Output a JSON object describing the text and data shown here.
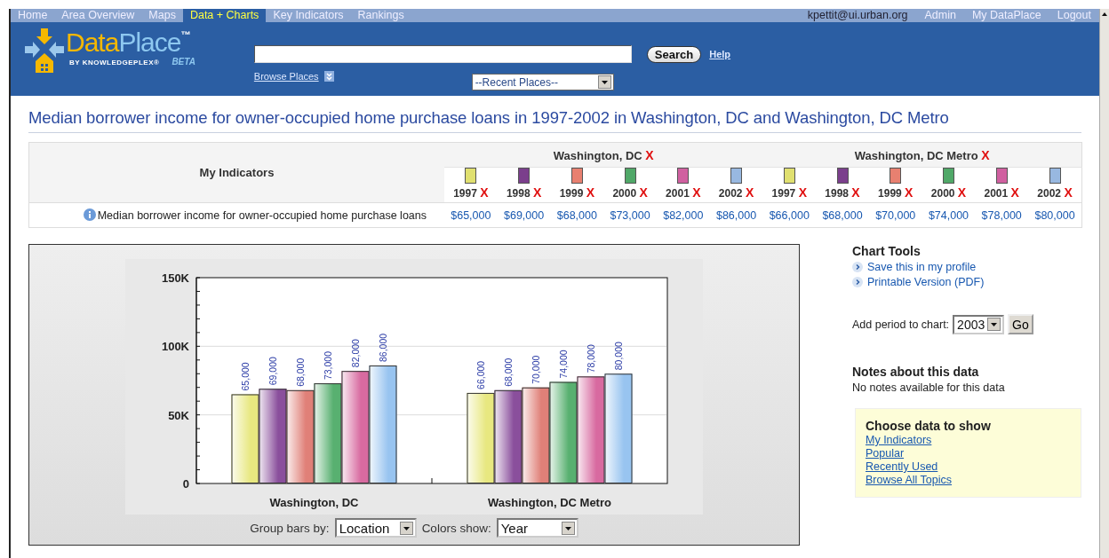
{
  "nav": {
    "tabs": [
      {
        "label": "Home",
        "selected": false
      },
      {
        "label": "Area Overview",
        "selected": false
      },
      {
        "label": "Maps",
        "selected": false
      },
      {
        "label": "Data + Charts",
        "selected": true
      },
      {
        "label": "Key Indicators",
        "selected": false
      },
      {
        "label": "Rankings",
        "selected": false
      }
    ],
    "user": "kpettit@ui.urban.org",
    "links": [
      "Admin",
      "My DataPlace",
      "Logout"
    ]
  },
  "header": {
    "logo": {
      "word_parts": [
        "Data",
        "Place"
      ],
      "trademark": "™",
      "byline": "BY KNOWLEDGEPLEX®",
      "beta": "BETA"
    },
    "search_button": "Search",
    "help": "Help",
    "browse": "Browse Places",
    "recent": "--Recent Places--"
  },
  "title": "Median borrower income for owner-occupied home purchase loans in 1997-2002 in Washington, DC and Washington, DC Metro",
  "table": {
    "corner": "My Indicators",
    "groups": [
      {
        "name": "Washington, DC",
        "remove": "X",
        "columns": [
          {
            "year": "1997",
            "remove": "X",
            "color": "#e0e070"
          },
          {
            "year": "1998",
            "remove": "X",
            "color": "#7b3f8c"
          },
          {
            "year": "1999",
            "remove": "X",
            "color": "#e88070"
          },
          {
            "year": "2000",
            "remove": "X",
            "color": "#50a868"
          },
          {
            "year": "2001",
            "remove": "X",
            "color": "#d060a0"
          },
          {
            "year": "2002",
            "remove": "X",
            "color": "#98b8e0"
          }
        ]
      },
      {
        "name": "Washington, DC Metro",
        "remove": "X",
        "columns": [
          {
            "year": "1997",
            "remove": "X",
            "color": "#e0e070"
          },
          {
            "year": "1998",
            "remove": "X",
            "color": "#7b3f8c"
          },
          {
            "year": "1999",
            "remove": "X",
            "color": "#e88070"
          },
          {
            "year": "2000",
            "remove": "X",
            "color": "#50a868"
          },
          {
            "year": "2001",
            "remove": "X",
            "color": "#d060a0"
          },
          {
            "year": "2002",
            "remove": "X",
            "color": "#98b8e0"
          }
        ]
      }
    ],
    "rows": [
      {
        "indicator": "Median borrower income for owner-occupied home purchase loans",
        "values": [
          "$65,000",
          "$69,000",
          "$68,000",
          "$73,000",
          "$82,000",
          "$86,000",
          "$66,000",
          "$68,000",
          "$70,000",
          "$74,000",
          "$78,000",
          "$80,000"
        ]
      }
    ]
  },
  "chart": {
    "chart_data": {
      "type": "bar",
      "categories": [
        "Washington, DC",
        "Washington, DC Metro"
      ],
      "series": [
        {
          "color": "#e8e880",
          "values": [
            65000,
            66000
          ],
          "value_labels": [
            "65,000",
            "66,000"
          ]
        },
        {
          "color": "#8a4f9c",
          "values": [
            69000,
            68000
          ],
          "value_labels": [
            "69,000",
            "68,000"
          ]
        },
        {
          "color": "#e08078",
          "values": [
            68000,
            70000
          ],
          "value_labels": [
            "68,000",
            "70,000"
          ]
        },
        {
          "color": "#58b070",
          "values": [
            73000,
            74000
          ],
          "value_labels": [
            "73,000",
            "74,000"
          ]
        },
        {
          "color": "#d86aa0",
          "values": [
            82000,
            78000
          ],
          "value_labels": [
            "82,000",
            "78,000"
          ]
        },
        {
          "color": "#98c4f0",
          "values": [
            86000,
            80000
          ],
          "value_labels": [
            "86,000",
            "80,000"
          ]
        }
      ],
      "ylim": [
        0,
        150000
      ],
      "yticks": [
        0,
        {
          "value": 50000,
          "label": "50K"
        },
        {
          "value": 100000,
          "label": "100K"
        },
        {
          "value": 150000,
          "label": "150K"
        }
      ]
    },
    "group_label": "Group bars by:",
    "group_value": "Location",
    "colors_label": "Colors show:",
    "colors_value": "Year"
  },
  "tools": {
    "title": "Chart Tools",
    "links": [
      "Save this in my profile",
      "Printable Version (PDF)"
    ],
    "period_label": "Add period to chart:",
    "period_value": "2003",
    "go": "Go",
    "notes_title": "Notes about this data",
    "notes_text": "No notes available for this data",
    "choose_title": "Choose data to show",
    "choose_links": [
      "My Indicators",
      "Popular",
      "Recently Used",
      "Browse All Topics"
    ]
  }
}
